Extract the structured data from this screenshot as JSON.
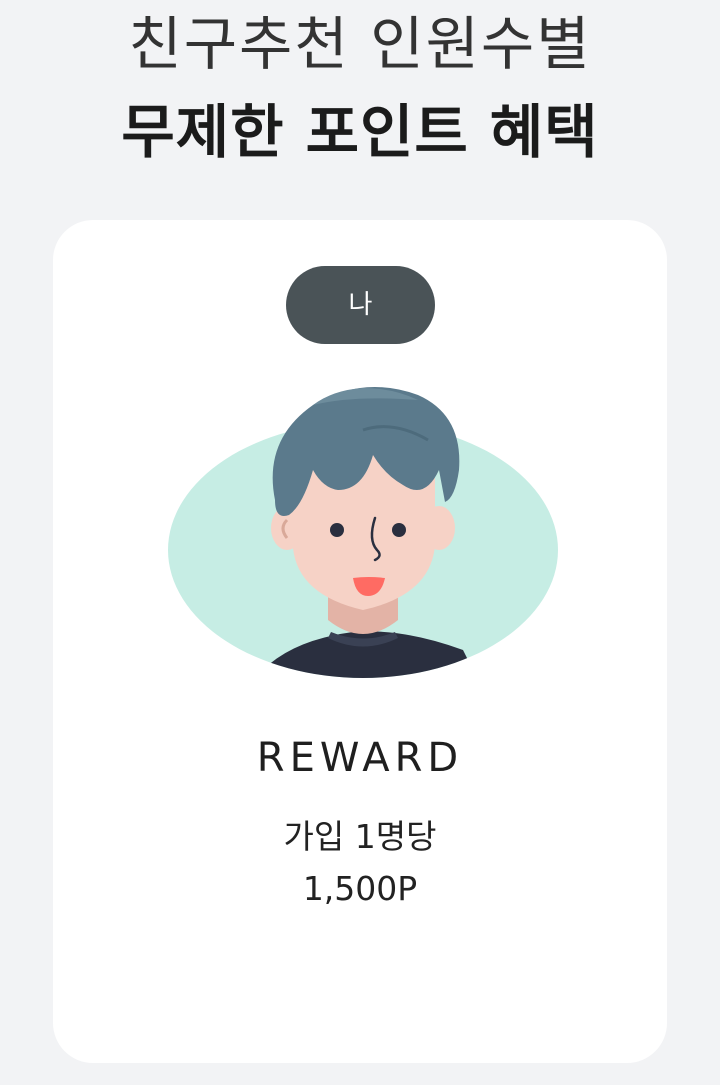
{
  "headline": {
    "line1": "친구추천 인원수별",
    "line2": "무제한 포인트 혜택"
  },
  "card": {
    "badge_label": "나",
    "avatar_icon": "boy-avatar-illustration",
    "reward_title": "REWARD",
    "reward_desc": "가입 1명당",
    "reward_amount": "1,500P"
  },
  "colors": {
    "background": "#f2f3f5",
    "card": "#ffffff",
    "badge": "#4a5357",
    "avatar_blob": "#c6ede4",
    "hair": "#5b7a8c",
    "skin": "#f6d2c6",
    "shirt": "#2a2f3f",
    "mouth": "#ff6b63"
  }
}
